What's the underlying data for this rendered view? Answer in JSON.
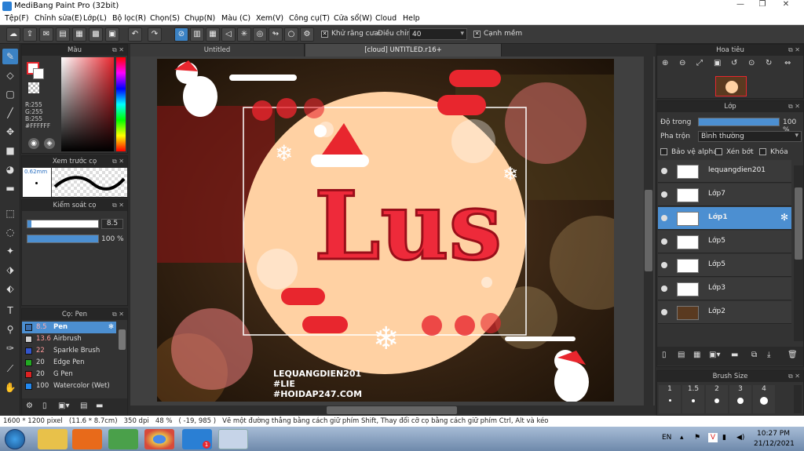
{
  "window": {
    "title": "MediBang Paint Pro (32bit)"
  },
  "menu": [
    "Tệp(F)",
    "Chỉnh sửa(E)",
    "Lớp(L)",
    "Bộ lọc(R)",
    "Chọn(S)",
    "Chụp(N)",
    "Màu (C)",
    "Xem(V)",
    "Công cụ(T)",
    "Cửa sổ(W)",
    "Cloud",
    "Help"
  ],
  "toolbar": {
    "antialias_label": "Khử răng cưa",
    "adjust_label": "Điều chỉnh",
    "adjust_value": "40",
    "edge_label": "Cạnh mềm"
  },
  "color_panel": {
    "title": "Màu",
    "r": "R:255",
    "g": "G:255",
    "b": "B:255",
    "hex": "#FFFFFF"
  },
  "brush_preview": {
    "title": "Xem trước cọ",
    "size": "0.62mm"
  },
  "brush_control": {
    "title": "Kiểm soát cọ",
    "size_value": "8.5",
    "opacity_value": "100 %",
    "size_fill": 0.06,
    "opacity_fill": 1.0
  },
  "brush_list": {
    "title": "Cọ: Pen",
    "items": [
      {
        "size": "8.5",
        "name": "Pen",
        "color": "#3a6fb0"
      },
      {
        "size": "13.6",
        "name": "Airbrush",
        "color": "#cfcfcf"
      },
      {
        "size": "22",
        "name": "Sparkle Brush",
        "color": "#3355cc"
      },
      {
        "size": "20",
        "name": "Edge Pen",
        "color": "#22aa22"
      },
      {
        "size": "20",
        "name": "G Pen",
        "color": "#dd2222"
      },
      {
        "size": "100",
        "name": "Watercolor (Wet)",
        "color": "#2288ee"
      }
    ]
  },
  "tabs": [
    "Untitled",
    "[cloud] UNTITLED.r16+"
  ],
  "canvas": {
    "watermark": [
      "LEQUANGDIEN201",
      "#LIE",
      "#HOIDAP247.COM"
    ],
    "art_text": "Lus"
  },
  "navigator": {
    "title": "Hoa tiêu"
  },
  "layers_panel": {
    "title": "Lớp",
    "opacity_label": "Độ trong",
    "opacity_value": "100 %",
    "opacity_fill": 1.0,
    "blend_label": "Pha trộn",
    "blend_value": "Bình thường",
    "protect_alpha": "Bảo vệ alpha",
    "clipping": "Xén bớt",
    "lock": "Khóa",
    "layers": [
      "lequangdien201",
      "Lớp7",
      "Lớp1",
      "Lớp5",
      "Lớp5",
      "Lớp3",
      "Lớp2"
    ]
  },
  "brush_size": {
    "title": "Brush Size",
    "sizes": [
      "1",
      "1.5",
      "2",
      "3",
      "4"
    ]
  },
  "status": {
    "text": "1600 * 1200 pixel   (11.6 * 8.7cm)   350 dpi   48 %   ( -19, 985 )   Vẽ một đường thẳng bằng cách giữ phím Shift, Thay đổi cỡ cọ bằng cách giữ phím Ctrl, Alt và kéo"
  },
  "taskbar": {
    "lang": "EN",
    "time": "10:27 PM",
    "date": "21/12/2021",
    "zalo_badge": "1"
  },
  "colors": {
    "accent": "#4c8fd1",
    "panel": "#333333",
    "canvas_bg": "#ffd1a3",
    "red": "#e8262e"
  }
}
